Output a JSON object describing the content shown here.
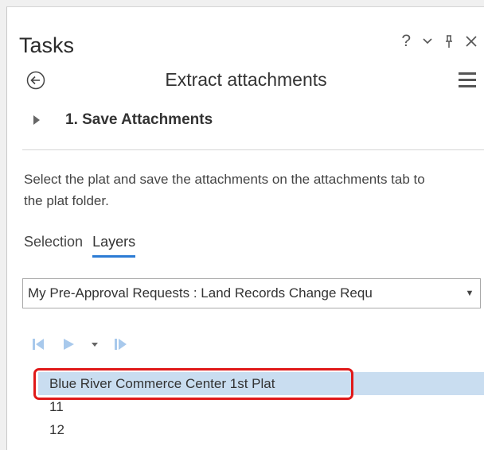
{
  "pane": {
    "title": "Tasks",
    "controls": {
      "help": "?",
      "dropdown": "⌄",
      "pin": "⊥",
      "close": "✕"
    }
  },
  "task": {
    "name": "Extract attachments"
  },
  "step": {
    "label": "1.  Save Attachments"
  },
  "instructions": "Select the plat and save the attachments on the attachments tab to the plat folder.",
  "tabs": [
    {
      "label": "Selection",
      "active": false
    },
    {
      "label": "Layers",
      "active": true
    }
  ],
  "layer_select": {
    "value": "My Pre-Approval Requests : Land Records Change Requ"
  },
  "features": [
    {
      "label": "Blue River Commerce Center 1st Plat",
      "selected": true
    },
    {
      "label": "11",
      "selected": false
    },
    {
      "label": "12",
      "selected": false
    }
  ],
  "colors": {
    "accent": "#2b7bd4",
    "selection": "#c9ddf0",
    "highlight": "#e01919",
    "nav_icon": "#a8c9ec"
  }
}
